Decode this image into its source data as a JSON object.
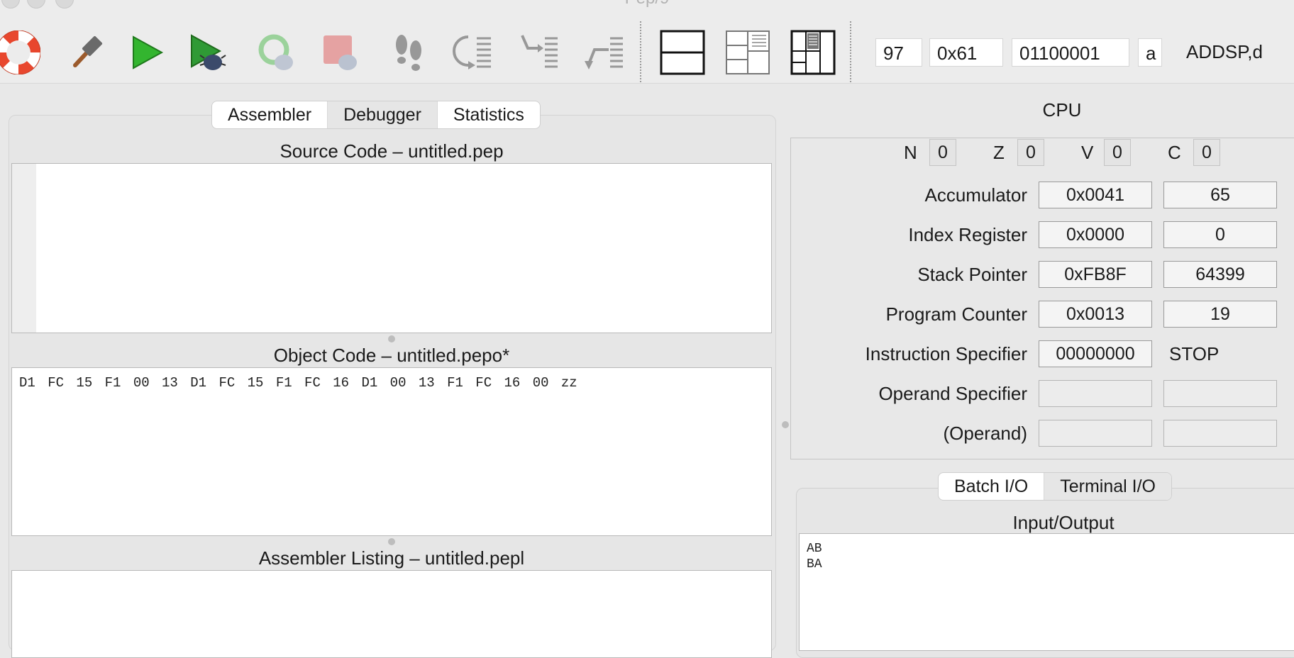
{
  "window": {
    "title": "Pep/9"
  },
  "toolbar": {
    "buttons": [
      {
        "name": "help-icon"
      },
      {
        "name": "build-hammer-icon"
      },
      {
        "name": "run-icon"
      },
      {
        "name": "debug-run-icon"
      },
      {
        "name": "continue-debug-icon"
      },
      {
        "name": "stop-debug-icon"
      },
      {
        "name": "single-step-icon"
      },
      {
        "name": "step-over-icon"
      },
      {
        "name": "step-into-icon"
      },
      {
        "name": "step-out-icon"
      }
    ],
    "layouts": [
      "code-only-layout-icon",
      "code-cpu-layout-icon",
      "code-cpu-memory-layout-icon"
    ],
    "converter": {
      "decimal": "97",
      "hex": "0x61",
      "binary": "01100001",
      "char": "a",
      "mnemonic": "ADDSP,d"
    }
  },
  "left_tabs": [
    {
      "label": "Assembler",
      "active": false
    },
    {
      "label": "Debugger",
      "active": true
    },
    {
      "label": "Statistics",
      "active": false
    }
  ],
  "source": {
    "title": "Source Code – untitled.pep",
    "content": ""
  },
  "object": {
    "title": "Object Code – untitled.pepo*",
    "content": "D1 FC 15 F1 00 13 D1 FC 15 F1 FC 16 D1 00 13 F1 FC 16 00 zz"
  },
  "listing": {
    "title": "Assembler Listing – untitled.pepl",
    "content": ""
  },
  "cpu": {
    "title": "CPU",
    "flags": [
      {
        "label": "N",
        "value": "0"
      },
      {
        "label": "Z",
        "value": "0"
      },
      {
        "label": "V",
        "value": "0"
      },
      {
        "label": "C",
        "value": "0"
      }
    ],
    "registers": [
      {
        "label": "Accumulator",
        "hex": "0x0041",
        "dec": "65"
      },
      {
        "label": "Index Register",
        "hex": "0x0000",
        "dec": "0"
      },
      {
        "label": "Stack Pointer",
        "hex": "0xFB8F",
        "dec": "64399"
      },
      {
        "label": "Program Counter",
        "hex": "0x0013",
        "dec": "19"
      },
      {
        "label": "Instruction Specifier",
        "hex": "00000000",
        "dec": "STOP"
      },
      {
        "label": "Operand Specifier",
        "hex": "",
        "dec": ""
      },
      {
        "label": "(Operand)",
        "hex": "",
        "dec": ""
      }
    ]
  },
  "io_tabs": [
    {
      "label": "Batch I/O",
      "active": false
    },
    {
      "label": "Terminal I/O",
      "active": true
    }
  ],
  "io": {
    "title": "Input/Output",
    "lines": [
      "AB",
      "BA"
    ]
  }
}
